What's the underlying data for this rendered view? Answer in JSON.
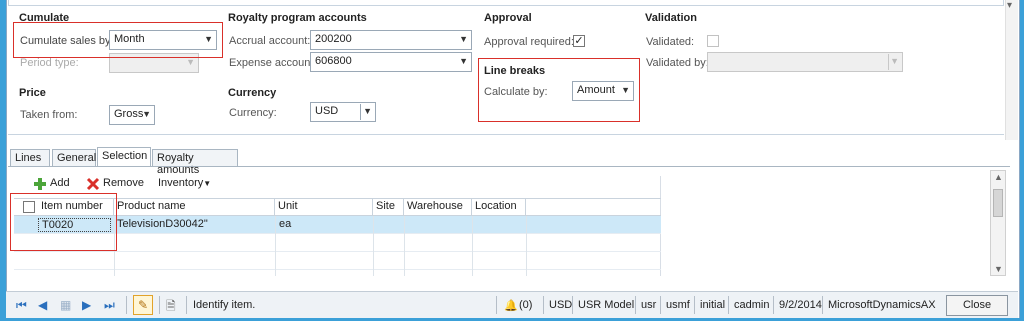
{
  "cumulate": {
    "heading": "Cumulate",
    "cumulate_label": "Cumulate sales by:",
    "cumulate_value": "Month",
    "period_label": "Period type:",
    "period_value": ""
  },
  "price": {
    "heading": "Price",
    "taken_from_label": "Taken from:",
    "taken_from_value": "Gross"
  },
  "royalty": {
    "heading": "Royalty program accounts",
    "accrual_label": "Accrual account:",
    "accrual_value": "200200",
    "expense_label": "Expense account:",
    "expense_value": "606800"
  },
  "currency": {
    "heading": "Currency",
    "currency_label": "Currency:",
    "currency_value": "USD"
  },
  "approval": {
    "heading": "Approval",
    "required_label": "Approval required:",
    "required_checked": true
  },
  "line_breaks": {
    "heading": "Line breaks",
    "calc_label": "Calculate by:",
    "calc_value": "Amount"
  },
  "validation": {
    "heading": "Validation",
    "validated_label": "Validated:",
    "validated_checked": false,
    "validated_by_label": "Validated by:",
    "validated_by_value": ""
  },
  "tabs": [
    {
      "label": "Lines"
    },
    {
      "label": "General"
    },
    {
      "label": "Selection"
    },
    {
      "label": "Royalty amounts"
    }
  ],
  "toolbar": {
    "add_label": "Add",
    "remove_label": "Remove",
    "inventory_label": "Inventory"
  },
  "grid": {
    "columns": [
      "Item number",
      "Product name",
      "Unit",
      "Site",
      "Warehouse",
      "Location"
    ],
    "rows": [
      {
        "item_number": "T0020",
        "product_name": "TelevisionD30042\"",
        "unit": "ea",
        "site": "",
        "warehouse": "",
        "location": ""
      }
    ]
  },
  "status_bar": {
    "hint": "Identify item.",
    "notifications": "(0)",
    "currency": "USD",
    "model": "USR Model",
    "layer": "usr",
    "company": "usmf",
    "state": "initial",
    "user": "cadmin",
    "date": "9/2/2014",
    "app": "MicrosoftDynamicsAX",
    "close_label": "Close"
  },
  "colors": {
    "accent": "#3ba0d8",
    "highlight_box": "#d9302a",
    "selected_row": "#cde8f8",
    "nav_icon": "#2a6fbd"
  }
}
